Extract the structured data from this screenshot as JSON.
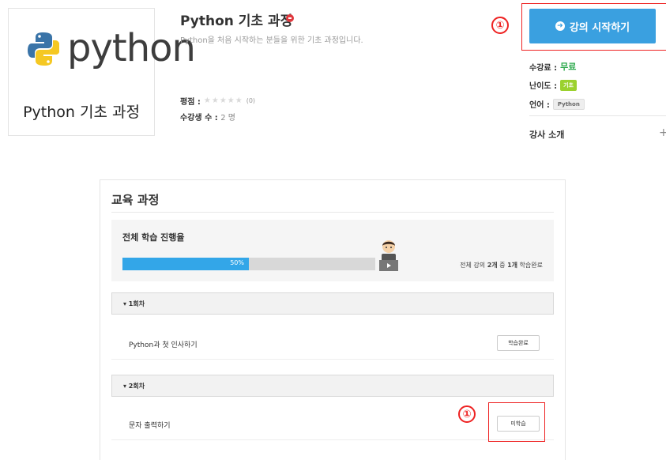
{
  "course": {
    "logo_text": "python",
    "thumbnail_caption": "Python 기초 과정",
    "title": "Python 기초 과정",
    "subtitle": "Python을 처음 시작하는 분들을 위한 기초 과정입니다.",
    "rating_label": "평점 :",
    "rating_stars": "★★★★★",
    "rating_count": "(0)",
    "students_label": "수강생 수 :",
    "students_value": "2 명"
  },
  "sidebar": {
    "start_button_label": "강의 시작하기",
    "fee_label": "수강료 :",
    "fee_value": "무료",
    "level_label": "난이도 :",
    "level_value": "기초",
    "language_label": "언어 :",
    "language_value": "Python",
    "instructor_label": "강사 소개",
    "expand_symbol": "+"
  },
  "annotations": {
    "marker_top": "①",
    "marker_bottom": "①"
  },
  "curriculum": {
    "title": "교육 과정",
    "progress_label": "전체 학습 진행율",
    "progress_percent": 50,
    "progress_text": "50%",
    "summary_prefix": "전체 강의 ",
    "summary_total": "2개",
    "summary_mid": " 중 ",
    "summary_done": "1개",
    "summary_suffix": " 학습완료",
    "sections": [
      {
        "label": "▾ 1회차",
        "lessons": [
          {
            "title": "Python과 첫 인사하기",
            "status": "학습완료"
          }
        ]
      },
      {
        "label": "▾ 2회차",
        "lessons": [
          {
            "title": "문자 출력하기",
            "status": "미학습"
          }
        ]
      }
    ]
  },
  "colors": {
    "primary": "#3aa0e0",
    "progress": "#33a6e8",
    "free": "#2aa84a",
    "level_tag": "#9bd12e",
    "highlight": "#ee2222"
  }
}
